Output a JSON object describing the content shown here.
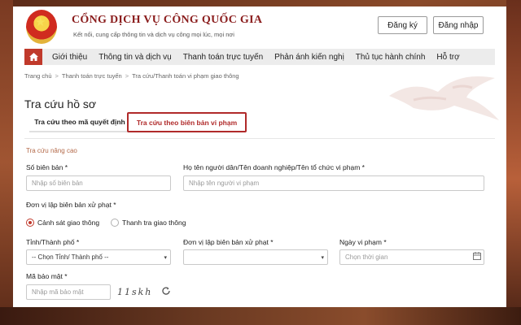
{
  "header": {
    "site_title": "CỔNG DỊCH VỤ CÔNG QUỐC GIA",
    "site_subtitle": "Kết nối, cung cấp thông tin và dịch vụ công mọi lúc, mọi nơi",
    "register_label": "Đăng ký",
    "login_label": "Đăng nhập"
  },
  "nav": {
    "items": [
      {
        "label": "Giới thiệu"
      },
      {
        "label": "Thông tin và dịch vụ"
      },
      {
        "label": "Thanh toán trực tuyến"
      },
      {
        "label": "Phản ánh kiến nghị"
      },
      {
        "label": "Thủ tục hành chính"
      },
      {
        "label": "Hỗ trợ"
      }
    ]
  },
  "breadcrumb": {
    "items": [
      "Trang chủ",
      "Thanh toán trực tuyến",
      "Tra cứu/Thanh toán vi phạm giao thông"
    ],
    "separator": ">"
  },
  "page": {
    "title": "Tra cứu hồ sơ"
  },
  "tabs": [
    {
      "label": "Tra cứu theo mã quyết định",
      "active": false
    },
    {
      "label": "Tra cứu theo biên bản vi phạm",
      "active": true
    }
  ],
  "form": {
    "section_label": "Tra cứu nâng cao",
    "record_no": {
      "label": "Số biên bản *",
      "placeholder": "Nhập số biên bản"
    },
    "violator_name": {
      "label": "Họ tên người dân/Tên doanh nghiệp/Tên tổ chức vi phạm *",
      "placeholder": "Nhập tên người vi phạm"
    },
    "issuing_unit_group": {
      "label": "Đơn vị lập biên bản xử phạt *"
    },
    "radio_options": [
      {
        "label": "Cảnh sát giao thông",
        "checked": true
      },
      {
        "label": "Thanh tra giao thông",
        "checked": false
      }
    ],
    "province": {
      "label": "Tỉnh/Thành phố *",
      "value": "-- Chọn Tỉnh/ Thành phố --"
    },
    "issuing_unit": {
      "label": "Đơn vị lập biên bản xử phạt *",
      "value": ""
    },
    "violation_date": {
      "label": "Ngày vi phạm *",
      "placeholder": "Chọn thời gian"
    },
    "captcha": {
      "label": "Mã bảo mật *",
      "placeholder": "Nhập mã bảo mật",
      "code": "11skh"
    }
  },
  "colors": {
    "brand_red": "#c0392b",
    "title_red": "#8a1c1c",
    "nav_bg": "#ececec"
  },
  "icons": {
    "home": "home-icon",
    "refresh": "refresh-icon",
    "calendar": "calendar-icon",
    "emblem": "national-emblem"
  }
}
